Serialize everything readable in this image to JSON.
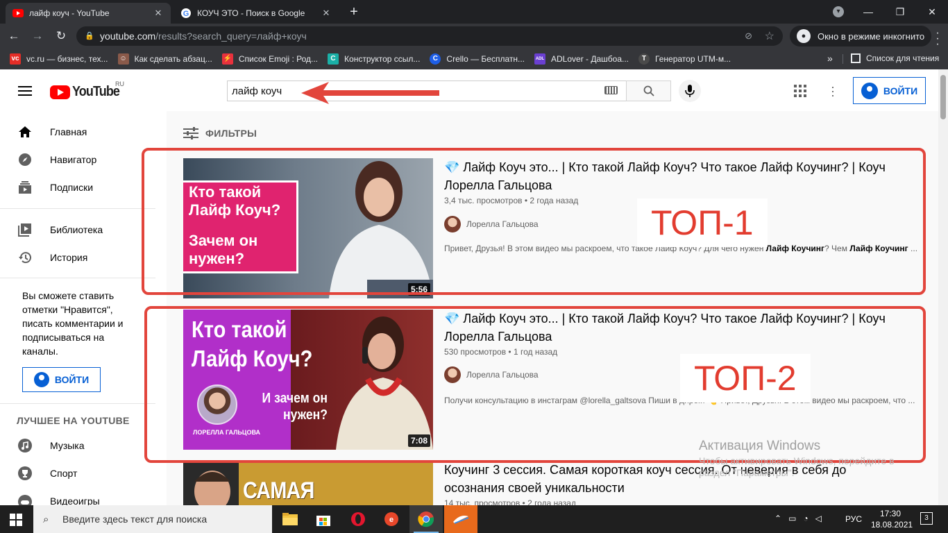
{
  "browser": {
    "tabs": [
      {
        "title": "лайф коуч - YouTube",
        "active": true
      },
      {
        "title": "КОУЧ ЭТО - Поиск в Google",
        "active": false
      }
    ],
    "url_host": "youtube.com",
    "url_path": "/results?search_query=лайф+коуч",
    "incognito_label": "Окно в режиме инкогнито",
    "bookmarks": [
      {
        "label": "vc.ru — бизнес, тех...",
        "color": "#e52d27",
        "glyph": "vc"
      },
      {
        "label": "Как сделать абзац...",
        "color": "#8a5a4a",
        "glyph": "☺"
      },
      {
        "label": "Список Emoji : Род...",
        "color": "#e8313d",
        "glyph": "⚡"
      },
      {
        "label": "Конструктор ссыл...",
        "color": "#1ab0a7",
        "glyph": "C"
      },
      {
        "label": "Crello — Бесплатн...",
        "color": "#1e5ee6",
        "glyph": "C"
      },
      {
        "label": "ADLover - Дашбоа...",
        "color": "#6a3fd1",
        "glyph": "ADL"
      },
      {
        "label": "Генератор UTM-м...",
        "color": "#4a4a4a",
        "glyph": "T"
      }
    ],
    "reading_list": "Список для чтения"
  },
  "youtube": {
    "logo_text": "YouTube",
    "region": "RU",
    "search_query": "лайф коуч",
    "signin_label": "ВОЙТИ",
    "filters_label": "ФИЛЬТРЫ"
  },
  "sidebar": {
    "primary": [
      {
        "label": "Главная",
        "icon": "home-icon"
      },
      {
        "label": "Навигатор",
        "icon": "compass-icon"
      },
      {
        "label": "Подписки",
        "icon": "subscriptions-icon"
      }
    ],
    "secondary": [
      {
        "label": "Библиотека",
        "icon": "library-icon"
      },
      {
        "label": "История",
        "icon": "history-icon"
      }
    ],
    "signin_prompt": "Вы сможете ставить отметки \"Нравится\", писать комментарии и подписываться на каналы.",
    "signin_label": "ВОЙТИ",
    "best_heading": "ЛУЧШЕЕ НА YOUTUBE",
    "best": [
      {
        "label": "Музыка",
        "icon": "music-icon"
      },
      {
        "label": "Спорт",
        "icon": "trophy-icon"
      },
      {
        "label": "Видеоигры",
        "icon": "gamepad-icon"
      }
    ]
  },
  "videos": [
    {
      "title": "💎 Лайф Коуч это... | Кто такой Лайф Коуч? Что такое Лайф Коучинг? | Коуч Лорелла Гальцова",
      "meta": "3,4 тыс. просмотров • 2 года назад",
      "channel": "Лорелла Гальцова",
      "desc_pre": "Привет, Друзья! В этом видео мы раскроем, что такое Лайф Коуч? Для чего нужен ",
      "desc_b1": "Лайф Коучинг",
      "desc_mid": "? Чем ",
      "desc_b2": "Лайф Коучинг",
      "desc_post": " ...",
      "duration": "5:56",
      "thumb_line1": "Кто такой",
      "thumb_line2": "Лайф Коуч?",
      "thumb_line3": "Зачем он",
      "thumb_line4": "нужен?"
    },
    {
      "title": "💎 Лайф Коуч это... | Кто такой Лайф Коуч? Что такое Лайф Коучинг? | Коуч Лорелла Гальцова",
      "meta": "530 просмотров • 1 год назад",
      "channel": "Лорелла Гальцова",
      "desc": "Получи консультацию в инстаграм @lorella_galtsova Пиши в директ 👆 Привет, Друзья! В этом видео мы раскроем, что ...",
      "duration": "7:08",
      "thumb_line1": "Кто такой",
      "thumb_line2": "Лайф Коуч?",
      "thumb_line3": "И зачем он",
      "thumb_line4": "нужен?",
      "thumb_caption": "ЛОРЕЛЛА ГАЛЬЦОВА"
    },
    {
      "title": "Коучинг 3 сессия. Самая короткая коуч сессия. От неверия в себя до осознания своей уникальности",
      "meta": "14 тыс. просмотров • 2 года назад",
      "thumb_text": "САМАЯ КОРОТКАЯ"
    }
  ],
  "annotations": {
    "top1": "ТОП-1",
    "top2": "ТОП-2",
    "accent": "#e2453c"
  },
  "windows_activation": {
    "title": "Активация Windows",
    "text": "Чтобы активировать Windows, перейдите в раздел \"Параметры\"."
  },
  "taskbar": {
    "search_placeholder": "Введите здесь текст для поиска",
    "language": "РУС",
    "time": "17:30",
    "date": "18.08.2021",
    "notifications": "3"
  }
}
